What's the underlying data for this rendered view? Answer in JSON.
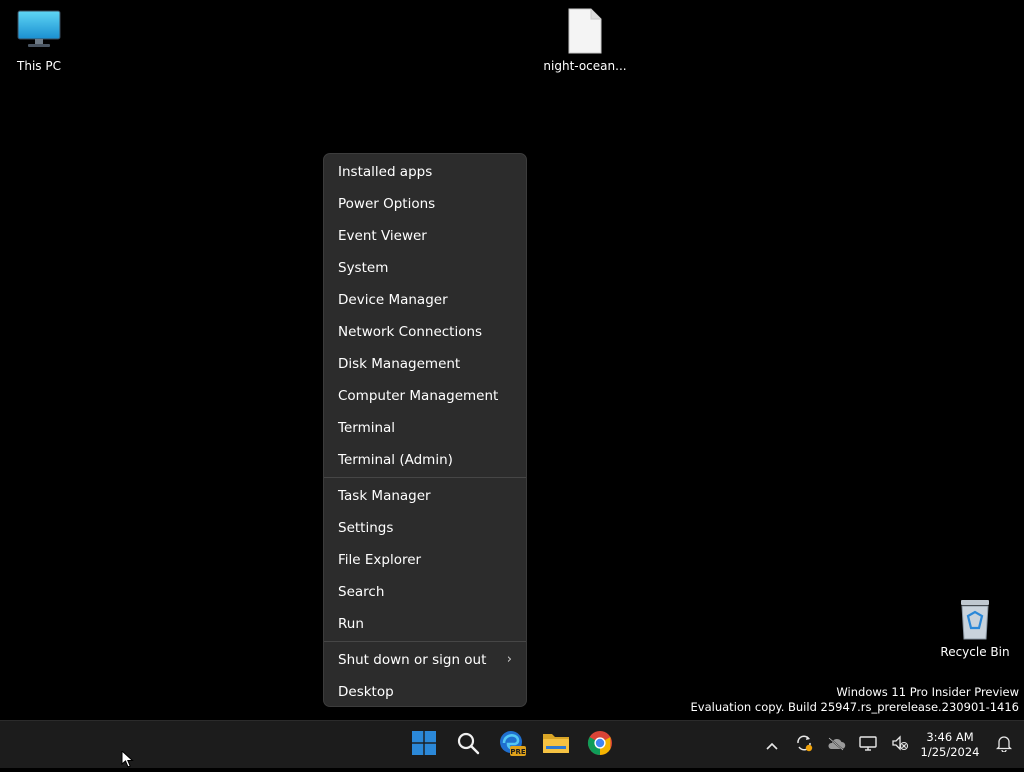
{
  "desktop": {
    "icons": [
      {
        "label": "This PC",
        "icon": "monitor-icon"
      },
      {
        "label": "night-ocean...",
        "icon": "file-icon"
      },
      {
        "label": "Recycle Bin",
        "icon": "recycle-bin-icon"
      }
    ]
  },
  "context_menu": {
    "group1": [
      {
        "label": "Installed apps"
      },
      {
        "label": "Power Options"
      },
      {
        "label": "Event Viewer"
      },
      {
        "label": "System"
      },
      {
        "label": "Device Manager"
      },
      {
        "label": "Network Connections"
      },
      {
        "label": "Disk Management"
      },
      {
        "label": "Computer Management"
      },
      {
        "label": "Terminal"
      },
      {
        "label": "Terminal (Admin)"
      }
    ],
    "group2": [
      {
        "label": "Task Manager"
      },
      {
        "label": "Settings"
      },
      {
        "label": "File Explorer"
      },
      {
        "label": "Search"
      },
      {
        "label": "Run"
      }
    ],
    "group3": [
      {
        "label": "Shut down or sign out",
        "has_submenu": true,
        "icon": "chevron-right-icon"
      },
      {
        "label": "Desktop"
      }
    ],
    "submenu_glyph": "›"
  },
  "watermark": {
    "line1": "Windows 11 Pro Insider Preview",
    "line2": "Evaluation copy. Build 25947.rs_prerelease.230901-1416"
  },
  "taskbar": {
    "apps": [
      "start-icon",
      "search-icon",
      "edge-beta-icon",
      "file-explorer-icon",
      "chrome-icon"
    ],
    "edge_badge": "PRE",
    "tray": {
      "icons": [
        "chevron-up-icon",
        "sync-icon",
        "onedrive-icon",
        "network-icon",
        "volume-muted-icon"
      ],
      "time": "3:46 AM",
      "date": "1/25/2024",
      "notification_icon": "bell-icon"
    }
  },
  "colors": {
    "desktop_bg": "#000000",
    "menu_bg": "#2c2c2c",
    "taskbar_bg": "#1c1c1c",
    "start_blue": "#2b88d8",
    "folder_yellow": "#f5c242"
  }
}
